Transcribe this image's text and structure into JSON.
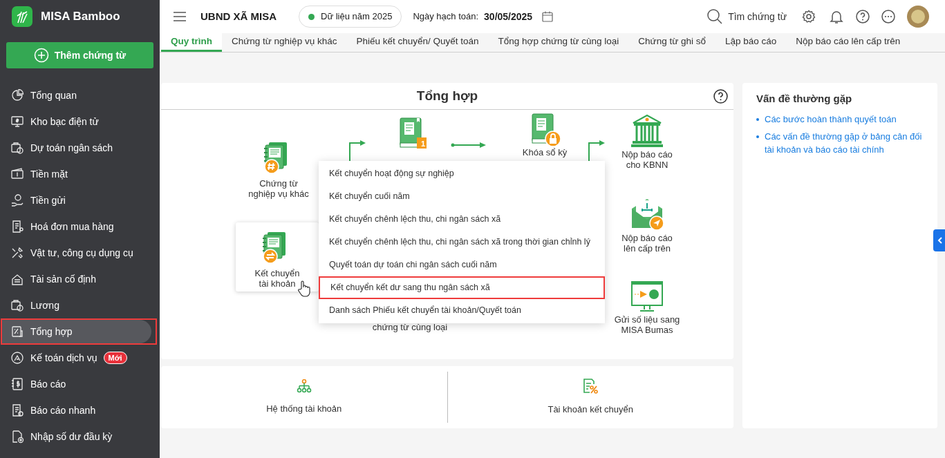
{
  "app": {
    "name": "MISA Bamboo"
  },
  "sidebar": {
    "add_button": "Thêm chứng từ",
    "items": [
      {
        "label": "Tổng quan",
        "selected": false,
        "highlighted": false
      },
      {
        "label": "Kho bạc điện tử",
        "selected": false,
        "highlighted": false
      },
      {
        "label": "Dự toán ngân sách",
        "selected": false,
        "highlighted": false
      },
      {
        "label": "Tiền mặt",
        "selected": false,
        "highlighted": false
      },
      {
        "label": "Tiền gửi",
        "selected": false,
        "highlighted": false
      },
      {
        "label": "Hoá đơn mua hàng",
        "selected": false,
        "highlighted": false
      },
      {
        "label": "Vật tư, công cụ dụng cụ",
        "selected": false,
        "highlighted": false
      },
      {
        "label": "Tài sản cố định",
        "selected": false,
        "highlighted": false
      },
      {
        "label": "Lương",
        "selected": false,
        "highlighted": false
      },
      {
        "label": "Tổng hợp",
        "selected": true,
        "highlighted": true
      },
      {
        "label": "Kế toán dịch vụ",
        "selected": false,
        "highlighted": false,
        "badge": "Mới"
      },
      {
        "label": "Báo cáo",
        "selected": false,
        "highlighted": false
      },
      {
        "label": "Báo cáo nhanh",
        "selected": false,
        "highlighted": false
      },
      {
        "label": "Nhập số dư đầu kỳ",
        "selected": false,
        "highlighted": false
      }
    ]
  },
  "header": {
    "org": "UBND XÃ MISA",
    "data_year": "Dữ liệu năm 2025",
    "date_label": "Ngày hạch toán:",
    "date": "30/05/2025",
    "search": "Tìm chứng từ"
  },
  "tabs": [
    {
      "label": "Quy trình",
      "selected": true
    },
    {
      "label": "Chứng từ nghiệp vụ khác",
      "selected": false
    },
    {
      "label": "Phiếu kết chuyển/ Quyết toán",
      "selected": false
    },
    {
      "label": "Tổng hợp chứng từ cùng loại",
      "selected": false
    },
    {
      "label": "Chứng từ ghi sổ",
      "selected": false
    },
    {
      "label": "Lập báo cáo",
      "selected": false
    },
    {
      "label": "Nộp báo cáo lên cấp trên",
      "selected": false
    }
  ],
  "workflow": {
    "title": "Tổng hợp",
    "nodes": [
      {
        "kind": "other_vouchers",
        "lines": [
          "Chứng từ",
          "nghiệp vụ khác"
        ]
      },
      {
        "kind": "transfer",
        "lines": [
          "Kết chuyển",
          "tài khoản"
        ]
      },
      {
        "kind": "ledger",
        "badge": "1"
      },
      {
        "kind": "lock",
        "lines": [
          "Khóa sổ kỳ"
        ]
      },
      {
        "kind": "same_type",
        "lines": [
          "chứng từ cùng loại"
        ]
      },
      {
        "kind": "treasury",
        "lines": [
          "Nộp báo cáo",
          "cho KBNN"
        ]
      },
      {
        "kind": "upper",
        "lines": [
          "Nộp báo cáo",
          "lên cấp trên"
        ]
      },
      {
        "kind": "bumas",
        "lines": [
          "Gửi số liệu sang",
          "MISA Bumas"
        ]
      }
    ]
  },
  "context_menu": [
    {
      "label": "Kết chuyển hoạt động sự nghiệp",
      "highlighted": false
    },
    {
      "label": "Kết chuyển cuối năm",
      "highlighted": false
    },
    {
      "label": "Kết chuyển chênh lệch thu, chi ngân sách xã",
      "highlighted": false
    },
    {
      "label": "Kết chuyển chênh lệch thu, chi ngân sách xã trong thời gian chỉnh lý",
      "highlighted": false
    },
    {
      "label": "Quyết toán dự toán chi ngân sách cuối năm",
      "highlighted": false
    },
    {
      "label": "Kết chuyển kết dư sang thu ngân sách xã",
      "highlighted": true
    },
    {
      "label": "Danh sách Phiếu kết chuyển tài khoản/Quyết toán",
      "highlighted": false
    }
  ],
  "shortcuts": [
    {
      "kind": "chart_of_accounts",
      "label": "Hệ thống tài khoản"
    },
    {
      "kind": "transfer_accounts",
      "label": "Tài khoản kết chuyển"
    }
  ],
  "common_issues": {
    "title": "Vấn đề thường gặp",
    "links": [
      "Các bước hoàn thành quyết toán",
      "Các vấn đề thường gặp ở bảng cân đối tài khoản và báo cáo tài chính"
    ]
  }
}
